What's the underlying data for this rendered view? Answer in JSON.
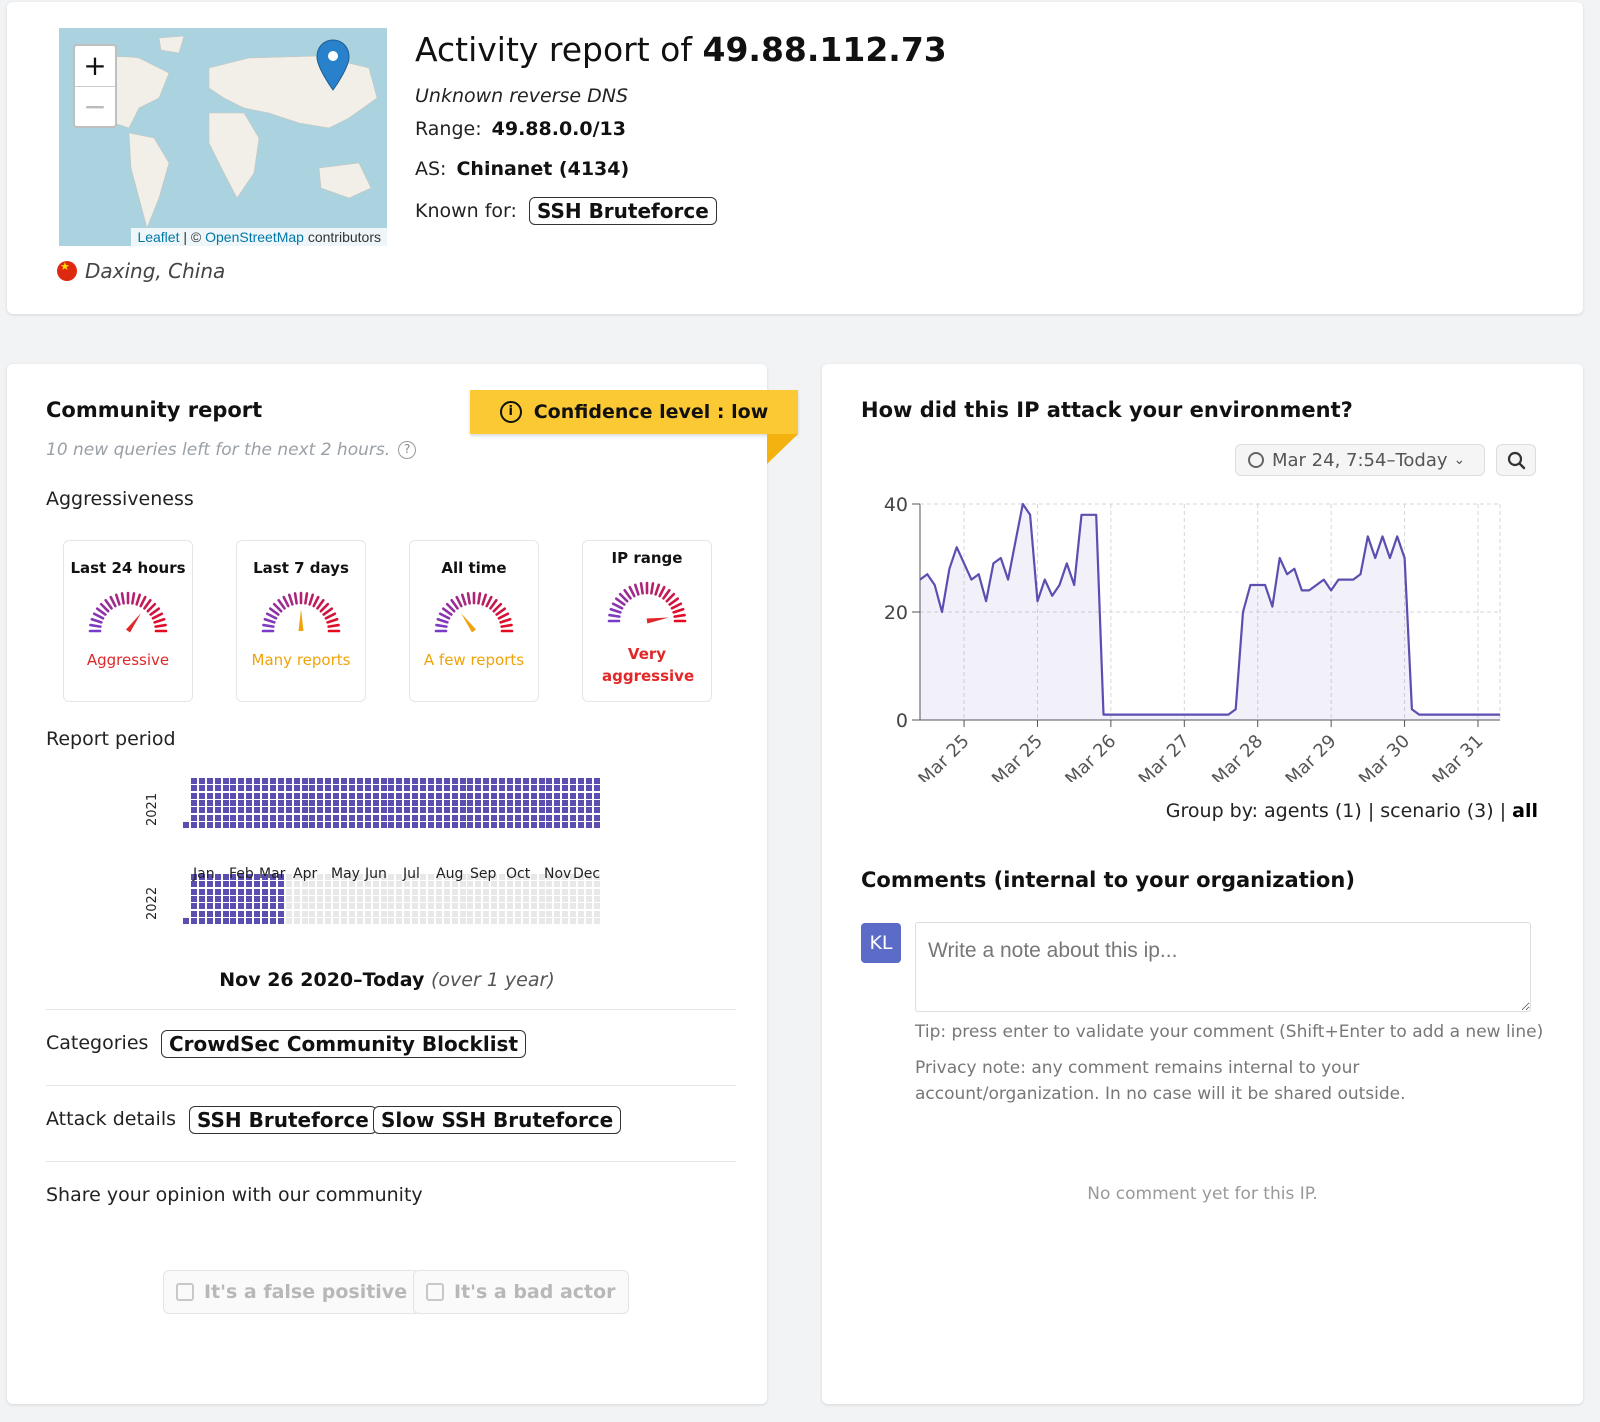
{
  "header": {
    "title_prefix": "Activity report of",
    "ip": "49.88.112.73",
    "reverse_dns": "Unknown reverse DNS",
    "range_label": "Range:",
    "range_value": "49.88.0.0/13",
    "as_label": "AS:",
    "as_value": "Chinanet (4134)",
    "known_for_label": "Known for:",
    "known_for_tag": "SSH Bruteforce",
    "location": "Daxing, China",
    "map": {
      "zoom_in": "+",
      "zoom_out": "−",
      "attribution_leaflet": "Leaflet",
      "attribution_sep": " | © ",
      "attribution_osm": "OpenStreetMap",
      "attribution_tail": " contributors"
    }
  },
  "community": {
    "title": "Community report",
    "queries_left": "10 new queries left for the next 2 hours.",
    "help_icon": "question-circle-icon",
    "confidence": "Confidence level : low",
    "aggressiveness_label": "Aggressiveness",
    "gauges": [
      {
        "title": "Last 24 hours",
        "label": "Aggressive",
        "level": 0.7,
        "color": "#e02828"
      },
      {
        "title": "Last 7 days",
        "label": "Many reports",
        "level": 0.5,
        "color": "#f0a30a"
      },
      {
        "title": "All time",
        "label": "A few reports",
        "level": 0.3,
        "color": "#f0a30a"
      },
      {
        "title": "IP range",
        "label": "Very aggressive",
        "level": 0.95,
        "color": "#e02828"
      }
    ],
    "report_period_label": "Report period",
    "years": [
      "2021",
      "2022"
    ],
    "months": [
      "Jan",
      "Feb",
      "Mar",
      "Apr",
      "May",
      "Jun",
      "Jul",
      "Aug",
      "Sep",
      "Oct",
      "Nov",
      "Dec"
    ],
    "period_text": "Nov 26 2020–Today",
    "period_note": "(over 1 year)",
    "categories_label": "Categories",
    "categories": [
      "CrowdSec Community Blocklist"
    ],
    "attack_details_label": "Attack details",
    "attack_details": [
      "SSH Bruteforce",
      "Slow SSH Bruteforce"
    ],
    "opinion_label": "Share your opinion with our community",
    "false_positive": "It's a false positive",
    "bad_actor": "It's a bad actor"
  },
  "attack": {
    "title": "How did this IP attack your environment?",
    "range_button": "Mar 24, 7:54–Today",
    "group_by_prefix": "Group by: agents (1) | scenario (3) |",
    "group_by_active": "all",
    "comments_title": "Comments (internal to your organization)",
    "avatar": "KL",
    "note_placeholder": "Write a note about this ip...",
    "tip": "Tip: press enter to validate your comment (Shift+Enter to add a new line)",
    "privacy": "Privacy note: any comment remains internal to your account/organization. In no case will it be shared outside.",
    "no_comment": "No comment yet for this IP."
  },
  "chart_data": {
    "type": "area",
    "ylim": [
      0,
      40
    ],
    "yticks": [
      0,
      20,
      40
    ],
    "xticks": [
      "Mar 25",
      "Mar 25",
      "Mar 26",
      "Mar 27",
      "Mar 28",
      "Mar 29",
      "Mar 30",
      "Mar 31"
    ],
    "grid": true,
    "series": [
      {
        "color": "#5a4fb0",
        "x": [
          0,
          0.1,
          0.2,
          0.3,
          0.4,
          0.5,
          0.6,
          0.7,
          0.8,
          0.9,
          1.0,
          1.1,
          1.2,
          1.3,
          1.4,
          1.5,
          1.6,
          1.7,
          1.8,
          1.9,
          2.0,
          2.1,
          2.2,
          2.3,
          2.4,
          2.5,
          2.6,
          2.7,
          2.8,
          2.9,
          3.0,
          3.1,
          3.2,
          3.3,
          3.4,
          3.5,
          3.6,
          3.7,
          3.8,
          3.9,
          4.0,
          4.1,
          4.2,
          4.3,
          4.4,
          4.5,
          4.6,
          4.7,
          4.8,
          4.9,
          5.0,
          5.1,
          5.2,
          5.3,
          5.4,
          5.5,
          5.6,
          5.7,
          5.8,
          5.9,
          6.0,
          6.1,
          6.2,
          6.3,
          6.4,
          6.5,
          6.6,
          6.7,
          6.8,
          6.9,
          7.0,
          7.1,
          7.2,
          7.3,
          7.4,
          7.5,
          7.6,
          7.7,
          7.8,
          7.9
        ],
        "y": [
          26,
          27,
          25,
          20,
          28,
          32,
          29,
          26,
          27,
          22,
          29,
          30,
          26,
          33,
          40,
          38,
          22,
          26,
          23,
          25,
          29,
          25,
          38,
          38,
          38,
          1,
          1,
          1,
          1,
          1,
          1,
          1,
          1,
          1,
          1,
          1,
          1,
          1,
          1,
          1,
          1,
          1,
          1,
          2,
          20,
          25,
          25,
          25,
          21,
          30,
          27,
          28,
          24,
          24,
          25,
          26,
          24,
          26,
          26,
          26,
          27,
          34,
          30,
          34,
          30,
          34,
          30,
          2,
          1,
          1,
          1,
          1,
          1,
          1,
          1,
          1,
          1,
          1,
          1,
          1
        ]
      }
    ]
  }
}
